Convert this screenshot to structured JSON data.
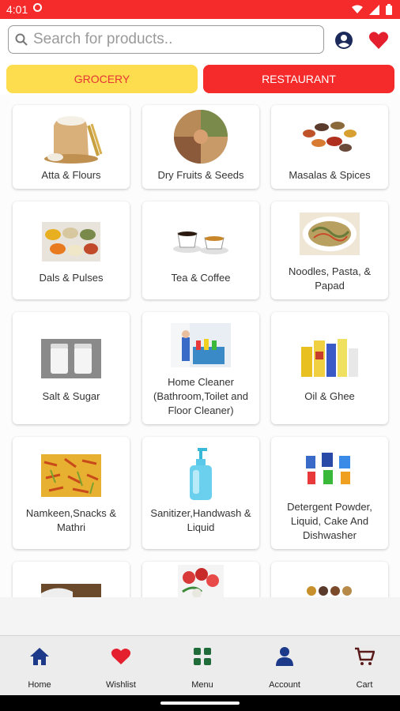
{
  "status": {
    "time": "4:01"
  },
  "search": {
    "placeholder": "Search for products.."
  },
  "tabs": {
    "grocery": "GROCERY",
    "restaurant": "RESTAURANT"
  },
  "categories": [
    {
      "label": "Atta & Flours",
      "icon": "flour-sack-image"
    },
    {
      "label": "Dry Fruits & Seeds",
      "icon": "dry-fruits-platter-image"
    },
    {
      "label": "Masalas & Spices",
      "icon": "spices-bowls-image"
    },
    {
      "label": "Dals & Pulses",
      "icon": "dals-bowls-image"
    },
    {
      "label": "Tea & Coffee",
      "icon": "tea-coffee-cups-image"
    },
    {
      "label": "Noodles, Pasta, & Papad",
      "icon": "noodles-plate-image"
    },
    {
      "label": "Salt & Sugar",
      "icon": "salt-sugar-jars-image"
    },
    {
      "label": "Home Cleaner (Bathroom,Toilet and Floor Cleaner)",
      "icon": "home-cleaner-image"
    },
    {
      "label": "Oil & Ghee",
      "icon": "oil-bottles-image"
    },
    {
      "label": "Namkeen,Snacks & Mathri",
      "icon": "namkeen-snacks-image"
    },
    {
      "label": "Sanitizer,Handwash & Liquid",
      "icon": "handwash-bottle-image"
    },
    {
      "label": "Detergent Powder, Liquid, Cake And Dishwasher",
      "icon": "detergent-packs-image"
    },
    {
      "label": "",
      "icon": "rice-sack-image"
    },
    {
      "label": "",
      "icon": "fresh-fruits-image"
    },
    {
      "label": "",
      "icon": "biscuits-image"
    }
  ],
  "nav": {
    "home": "Home",
    "wishlist": "Wishlist",
    "menu": "Menu",
    "account": "Account",
    "cart": "Cart"
  },
  "colors": {
    "primary": "#f52a2a",
    "accent_yellow": "#fddc4e",
    "nav_blue": "#1d3a8a",
    "nav_green": "#1f6b3a",
    "heart_red": "#e5202e",
    "cart_maroon": "#5b1a1a"
  }
}
